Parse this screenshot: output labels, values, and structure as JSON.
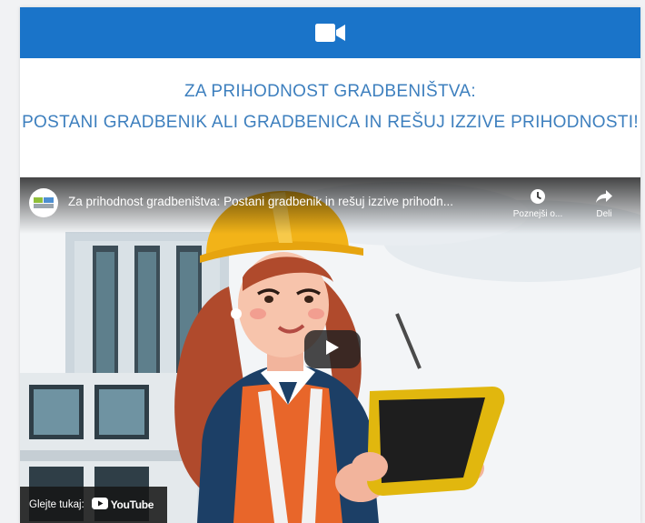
{
  "header": {
    "icon": "video-camera-icon",
    "accent_color": "#1a74c9"
  },
  "headline": {
    "line1": "ZA PRIHODNOST GRADBENIŠTVA:",
    "line2": "POSTANI GRADBENIK ALI GRADBENICA IN REŠUJ IZZIVE PRIHODNOSTI!",
    "color": "#3d7fbe"
  },
  "video": {
    "title": "Za prihodnost gradbeništva: Postani gradbenik in rešuj izzive prihodnosti!",
    "title_display": "Za prihodnost gradbeništva: Postani gradbenik in rešuj izzive prihodn...",
    "watch_later_label": "Poznejši o...",
    "share_label": "Deli",
    "watch_on_label": "Glejte tukaj:",
    "youtube_label": "YouTube"
  }
}
